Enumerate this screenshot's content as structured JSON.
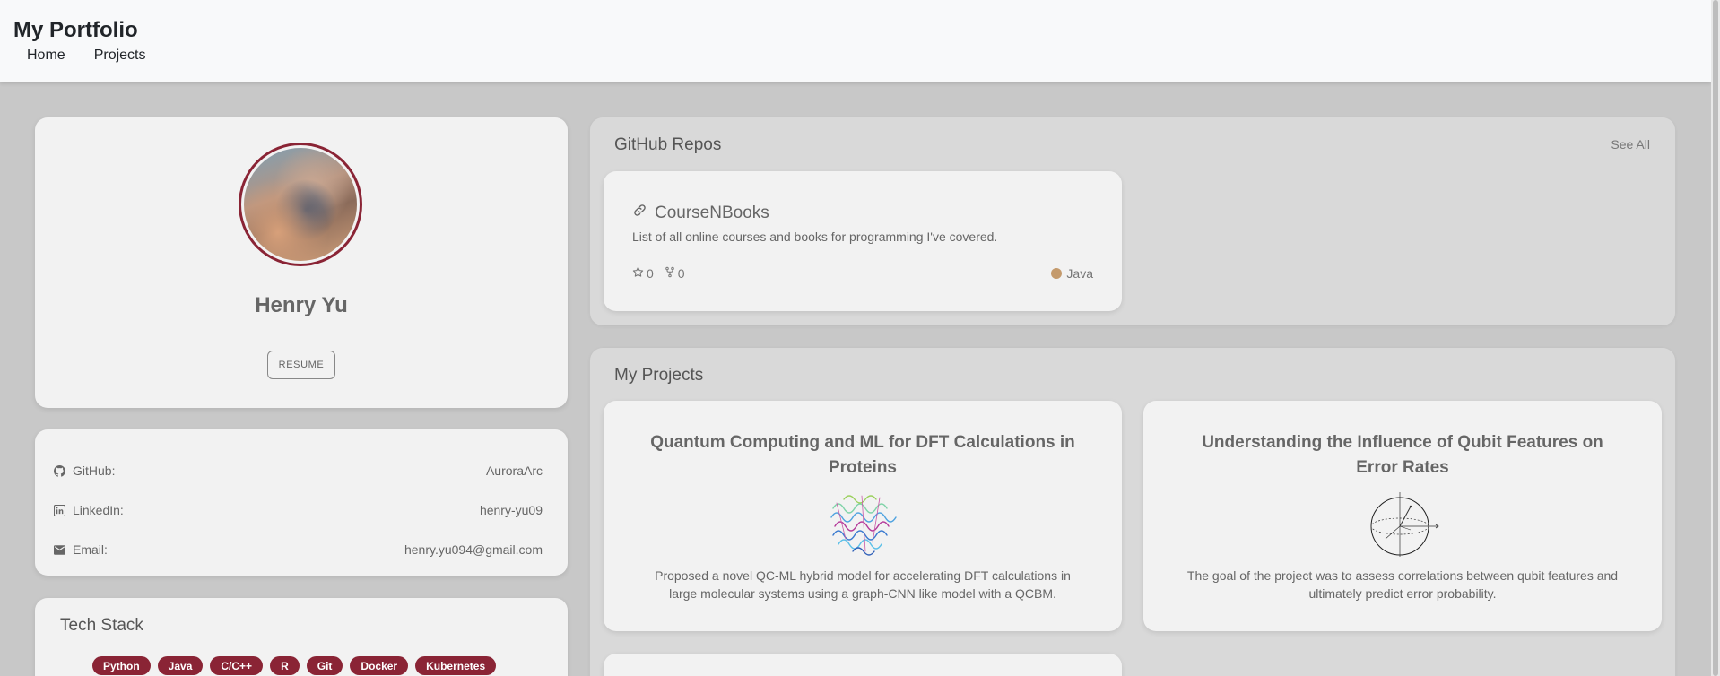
{
  "header": {
    "brand": "My Portfolio",
    "nav": [
      "Home",
      "Projects"
    ]
  },
  "profile": {
    "name": "Henry Yu",
    "resume_label": "RESUME"
  },
  "contacts": [
    {
      "label": "GitHub:",
      "value": "AuroraArc",
      "icon": "github-icon"
    },
    {
      "label": "LinkedIn:",
      "value": "henry-yu09",
      "icon": "linkedin-icon"
    },
    {
      "label": "Email:",
      "value": "henry.yu094@gmail.com",
      "icon": "mail-icon"
    }
  ],
  "tech_stack": {
    "title": "Tech Stack",
    "tags": [
      "Python",
      "Java",
      "C/C++",
      "R",
      "Git",
      "Docker",
      "Kubernetes"
    ],
    "tag_color": "#8a2435"
  },
  "github_repos": {
    "title": "GitHub Repos",
    "see_all": "See All",
    "repos": [
      {
        "name": "CourseNBooks",
        "description": "List of all online courses and books for programming I've covered.",
        "stars": "0",
        "forks": "0",
        "language": "Java",
        "language_color": "#c49a6c"
      }
    ]
  },
  "projects": {
    "title": "My Projects",
    "items": [
      {
        "title": "Quantum Computing and ML for DFT Calculations in Proteins",
        "description": "Proposed a novel QC-ML hybrid model for accelerating DFT calculations in large molecular systems using a graph-CNN like model with a QCBM.",
        "image": "protein-structure-image"
      },
      {
        "title": "Understanding the Influence of Qubit Features on Error Rates",
        "description": "The goal of the project was to assess correlations between qubit features and ultimately predict error probability.",
        "image": "bloch-sphere-image"
      }
    ]
  }
}
